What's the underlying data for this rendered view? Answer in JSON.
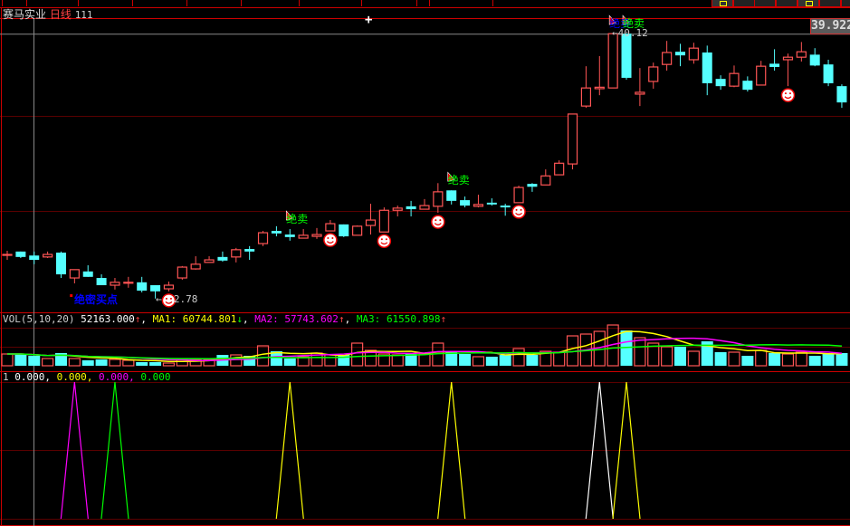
{
  "header": {
    "stock_name": "赛马实业",
    "period": "日线",
    "code_suffix": "111"
  },
  "current_price_label": "39.922",
  "markers": {
    "high_label": "40.12",
    "low_label": "2.78",
    "arrow": "←"
  },
  "signals": {
    "buy_label": "绝密买点",
    "sell_label": "绝卖",
    "buy_index": 6,
    "sells": [
      {
        "index": 21,
        "color": "#00ff00"
      },
      {
        "index": 33,
        "color": "#00ff00"
      },
      {
        "index": 45,
        "color": "#0000ff"
      },
      {
        "index": 46,
        "color": "#00ff00"
      }
    ],
    "smiley_indices": [
      12,
      24,
      28,
      32,
      38,
      58
    ]
  },
  "volume_header": {
    "title": "VOL(5,10,20)",
    "vol": "52163.000",
    "vol_arrow": "↑",
    "ma1_label": "MA1:",
    "ma1": "60744.801",
    "ma1_arrow": "↓",
    "ma2_label": "MA2:",
    "ma2": "57743.602",
    "ma2_arrow": "↑",
    "ma3_label": "MA3:",
    "ma3": "61550.898",
    "ma3_arrow": "↑"
  },
  "indicator_header": {
    "name": "1",
    "v1": "0.000",
    "v2": "0.000",
    "v3": "0.000",
    "v4": "0.000"
  },
  "colors": {
    "up": "#ff5555",
    "down": "#55ffff",
    "ma1": "#ffff00",
    "ma2": "#ff00ff",
    "ma3": "#00ff00",
    "grid": "#5a0000",
    "border": "#cc0000"
  },
  "chart_data": {
    "type": "candlestick",
    "ylim": [
      32.42,
      40.55
    ],
    "ohlc": [
      [
        34.02,
        34.02,
        34.12,
        33.87
      ],
      [
        34.1,
        33.95,
        34.1,
        33.92
      ],
      [
        33.99,
        33.87,
        34.1,
        33.75
      ],
      [
        33.95,
        34.02,
        34.1,
        33.92
      ],
      [
        34.07,
        33.47,
        34.1,
        33.37
      ],
      [
        33.37,
        33.6,
        33.6,
        33.22
      ],
      [
        33.55,
        33.4,
        33.72,
        33.4
      ],
      [
        33.37,
        33.17,
        33.47,
        33.17
      ],
      [
        33.17,
        33.25,
        33.37,
        33.05
      ],
      [
        33.25,
        33.25,
        33.4,
        33.1
      ],
      [
        33.25,
        33.02,
        33.4,
        32.97
      ],
      [
        33.17,
        33.0,
        33.17,
        32.8
      ],
      [
        33.07,
        33.17,
        33.27,
        33.0
      ],
      [
        33.37,
        33.67,
        33.7,
        33.32
      ],
      [
        33.62,
        33.75,
        33.97,
        33.6
      ],
      [
        33.8,
        33.87,
        33.97,
        33.8
      ],
      [
        33.95,
        33.85,
        34.1,
        33.82
      ],
      [
        33.95,
        34.15,
        34.2,
        33.8
      ],
      [
        34.17,
        34.1,
        34.25,
        33.87
      ],
      [
        34.32,
        34.62,
        34.67,
        34.25
      ],
      [
        34.67,
        34.6,
        34.8,
        34.52
      ],
      [
        34.57,
        34.5,
        34.72,
        34.4
      ],
      [
        34.47,
        34.55,
        34.72,
        34.47
      ],
      [
        34.52,
        34.57,
        34.75,
        34.45
      ],
      [
        34.67,
        34.87,
        34.97,
        34.67
      ],
      [
        34.85,
        34.52,
        34.85,
        34.5
      ],
      [
        34.55,
        34.8,
        34.82,
        34.55
      ],
      [
        34.82,
        34.97,
        35.42,
        34.57
      ],
      [
        34.64,
        35.24,
        35.32,
        34.64
      ],
      [
        35.24,
        35.3,
        35.37,
        35.07
      ],
      [
        35.35,
        35.27,
        35.5,
        35.07
      ],
      [
        35.27,
        35.37,
        35.55,
        35.27
      ],
      [
        35.35,
        35.75,
        35.99,
        35.17
      ],
      [
        35.79,
        35.5,
        35.79,
        35.4
      ],
      [
        35.52,
        35.37,
        35.62,
        35.32
      ],
      [
        35.35,
        35.4,
        35.67,
        35.32
      ],
      [
        35.45,
        35.4,
        35.57,
        35.37
      ],
      [
        35.37,
        35.32,
        35.42,
        35.09
      ],
      [
        35.45,
        35.87,
        35.92,
        35.45
      ],
      [
        35.97,
        35.89,
        35.99,
        35.75
      ],
      [
        35.94,
        36.19,
        36.37,
        35.94
      ],
      [
        36.22,
        36.54,
        36.62,
        36.22
      ],
      [
        36.52,
        37.9,
        37.9,
        36.37
      ],
      [
        38.12,
        38.62,
        39.22,
        38.07
      ],
      [
        38.6,
        38.64,
        39.5,
        38.42
      ],
      [
        38.62,
        40.12,
        40.12,
        38.62
      ],
      [
        40.12,
        38.9,
        40.12,
        38.85
      ],
      [
        38.45,
        38.5,
        39.17,
        38.12
      ],
      [
        38.8,
        39.2,
        39.32,
        38.6
      ],
      [
        39.27,
        39.6,
        39.92,
        39.1
      ],
      [
        39.62,
        39.52,
        39.84,
        39.22
      ],
      [
        39.4,
        39.72,
        39.87,
        39.29
      ],
      [
        39.6,
        38.75,
        39.79,
        38.42
      ],
      [
        38.87,
        38.67,
        38.97,
        38.57
      ],
      [
        38.67,
        39.02,
        39.24,
        38.64
      ],
      [
        38.82,
        38.57,
        38.94,
        38.52
      ],
      [
        38.7,
        39.22,
        39.37,
        38.7
      ],
      [
        39.29,
        39.2,
        39.69,
        39.1
      ],
      [
        39.4,
        39.47,
        39.57,
        38.67
      ],
      [
        39.47,
        39.62,
        39.89,
        39.35
      ],
      [
        39.54,
        39.24,
        39.72,
        39.22
      ],
      [
        39.27,
        38.75,
        39.4,
        38.67
      ],
      [
        38.67,
        38.22,
        38.72,
        38.07
      ]
    ],
    "volume": [
      48438,
      48438,
      40986,
      29808,
      52164,
      29808,
      22356,
      26082,
      26082,
      22356,
      14904,
      14904,
      11178,
      26082,
      26082,
      26082,
      44712,
      44712,
      40986,
      81972,
      59616,
      29808,
      37260,
      52164,
      44712,
      44712,
      93150,
      63342,
      48438,
      44712,
      48438,
      48438,
      93150,
      55890,
      48438,
      37260,
      37260,
      44712,
      70794,
      44712,
      59616,
      55890,
      122958,
      130410,
      141588,
      167670,
      145314,
      115506,
      93150,
      78246,
      78246,
      59616,
      100602,
      55890,
      55890,
      40986,
      63342,
      52164,
      48438,
      55890,
      40986,
      48438,
      52163
    ],
    "indicator_spikes": [
      {
        "index": 5,
        "color": "#ff00ff"
      },
      {
        "index": 8,
        "color": "#00ff00"
      },
      {
        "index": 21,
        "color": "#ffff00"
      },
      {
        "index": 33,
        "color": "#ffff00"
      },
      {
        "index": 44,
        "color": "#ffffff"
      },
      {
        "index": 46,
        "color": "#ffff00"
      }
    ]
  }
}
